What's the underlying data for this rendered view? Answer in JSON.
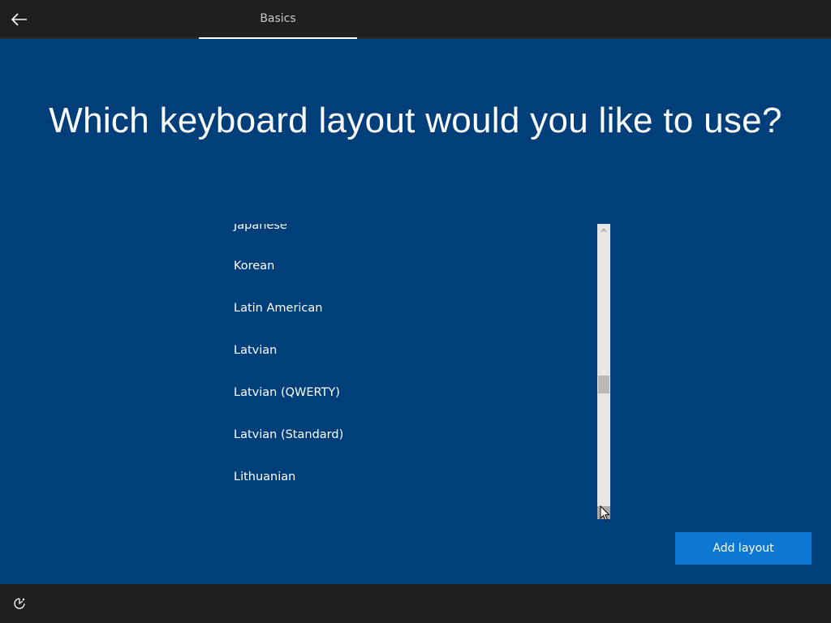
{
  "header": {
    "tab_label": "Basics"
  },
  "main": {
    "title": "Which keyboard layout would you like to use?",
    "layouts": [
      "Japanese",
      "Korean",
      "Latin American",
      "Latvian",
      "Latvian (QWERTY)",
      "Latvian (Standard)",
      "Lithuanian"
    ],
    "add_button_label": "Add layout",
    "scroll_position": 0.55
  },
  "icons": {
    "back": "back-arrow-icon",
    "scroll_up": "chevron-up-icon",
    "scroll_down": "chevron-down-icon",
    "ease_of_access": "ease-of-access-icon"
  },
  "colors": {
    "background": "#003f79",
    "bar": "#1f1f1f",
    "accent": "#0d78d4",
    "scrollbar": "#e6e6e6"
  }
}
